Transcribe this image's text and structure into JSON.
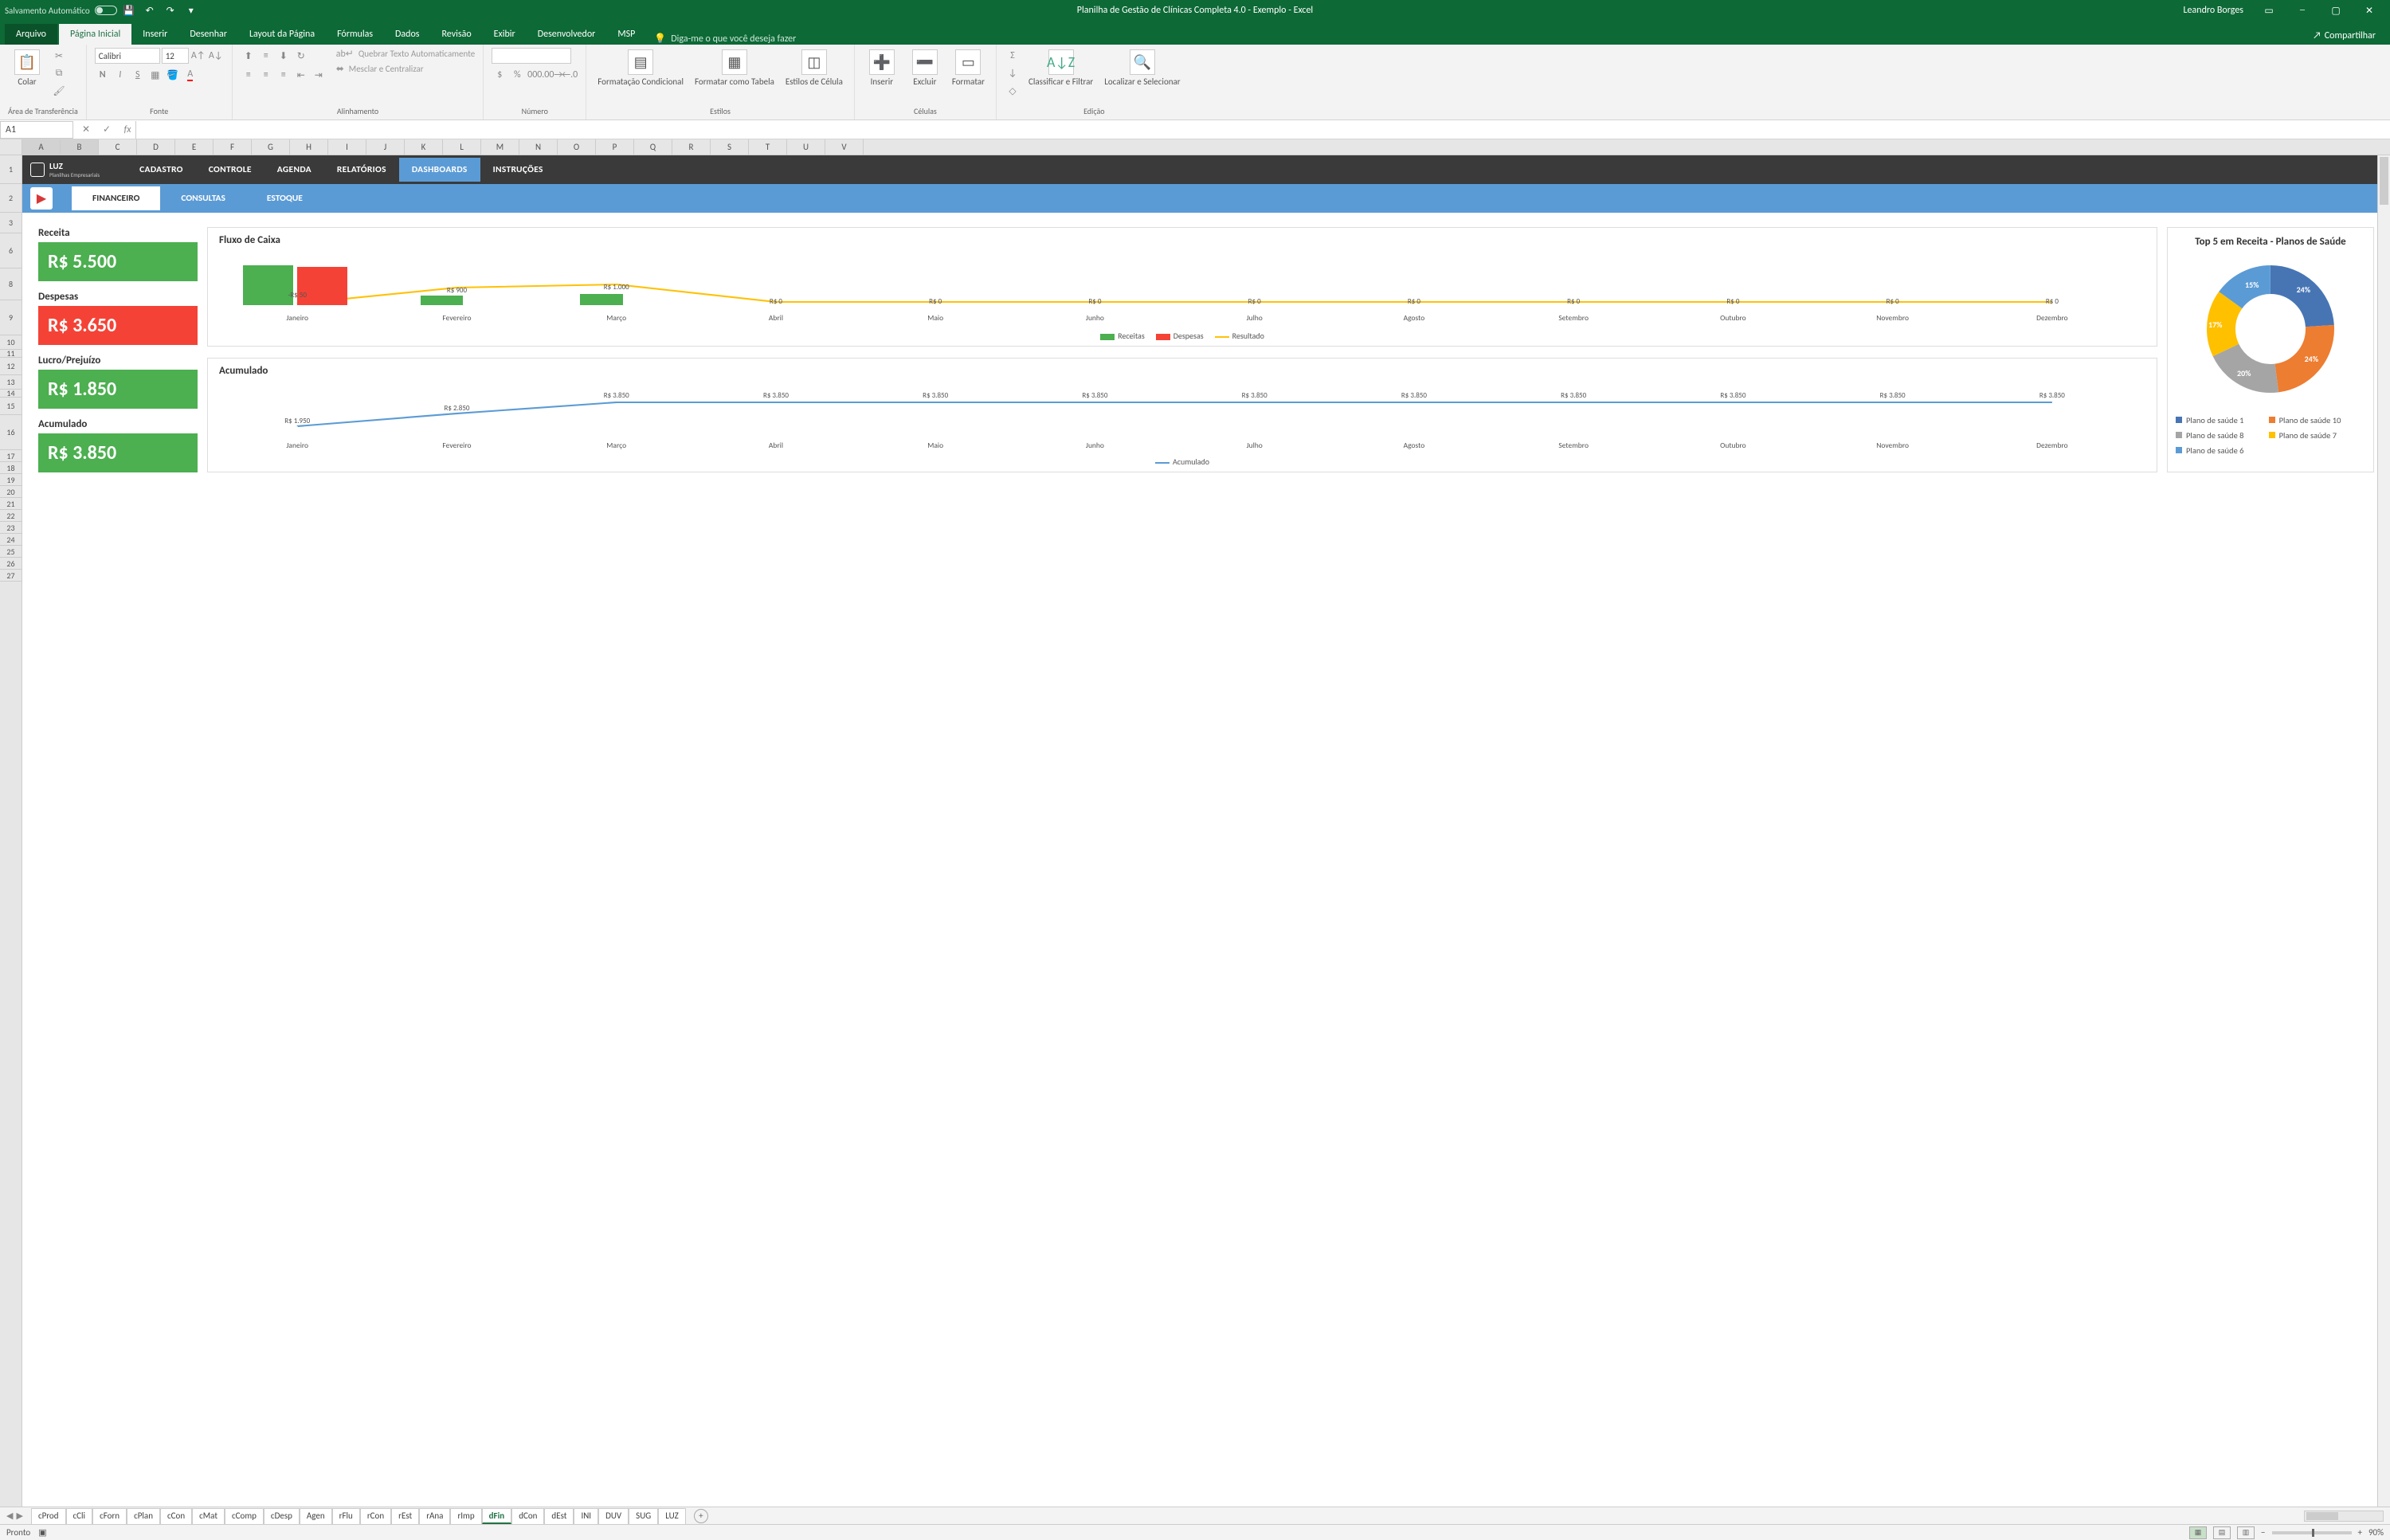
{
  "title_bar": {
    "autosave_label": "Salvamento Automático",
    "doc_title": "Planilha de Gestão de Clínicas Completa 4.0 - Exemplo  -  Excel",
    "user": "Leandro Borges"
  },
  "ribbon_tabs": {
    "file": "Arquivo",
    "tabs": [
      "Página Inicial",
      "Inserir",
      "Desenhar",
      "Layout da Página",
      "Fórmulas",
      "Dados",
      "Revisão",
      "Exibir",
      "Desenvolvedor",
      "MSP"
    ],
    "active_index": 0,
    "tell_me": "Diga-me o que você deseja fazer",
    "share": "Compartilhar"
  },
  "ribbon": {
    "clipboard": {
      "paste": "Colar",
      "group": "Área de Transferência"
    },
    "font": {
      "name": "Calibri",
      "size": "12",
      "group": "Fonte"
    },
    "alignment": {
      "wrap": "Quebrar Texto Automaticamente",
      "merge": "Mesclar e Centralizar",
      "group": "Alinhamento"
    },
    "number": {
      "group": "Número"
    },
    "styles": {
      "cond": "Formatação Condicional",
      "table": "Formatar como Tabela",
      "cell": "Estilos de Célula",
      "group": "Estilos"
    },
    "cells": {
      "insert": "Inserir",
      "delete": "Excluir",
      "format": "Formatar",
      "group": "Células"
    },
    "editing": {
      "sort": "Classificar e Filtrar",
      "find": "Localizar e Selecionar",
      "group": "Edição"
    }
  },
  "namebox": "A1",
  "columns": [
    "A",
    "B",
    "C",
    "D",
    "E",
    "F",
    "G",
    "H",
    "I",
    "J",
    "K",
    "L",
    "M",
    "N",
    "O",
    "P",
    "Q",
    "R",
    "S",
    "T",
    "U",
    "V"
  ],
  "rows": [
    "1",
    "2",
    "3",
    "6",
    "8",
    "9",
    "10",
    "11",
    "12",
    "13",
    "14",
    "15",
    "16",
    "17",
    "18",
    "19",
    "20",
    "21",
    "22",
    "23",
    "24",
    "25",
    "26",
    "27"
  ],
  "nav": {
    "brand": "LUZ",
    "brand_sub": "Planilhas Empresariais",
    "items": [
      "CADASTRO",
      "CONTROLE",
      "AGENDA",
      "RELATÓRIOS",
      "DASHBOARDS",
      "INSTRUÇÕES"
    ],
    "active_index": 4,
    "subtabs": [
      "FINANCEIRO",
      "CONSULTAS",
      "ESTOQUE"
    ],
    "sub_active_index": 0
  },
  "kpis": [
    {
      "label": "Receita",
      "value": "R$ 5.500",
      "color": "kg"
    },
    {
      "label": "Despesas",
      "value": "R$ 3.650",
      "color": "kr"
    },
    {
      "label": "Lucro/Prejuízo",
      "value": "R$ 1.850",
      "color": "kg"
    },
    {
      "label": "Acumulado",
      "value": "R$ 3.850",
      "color": "kg"
    }
  ],
  "chart_data": [
    {
      "type": "bar",
      "title": "Fluxo de Caixa",
      "categories": [
        "Janeiro",
        "Fevereiro",
        "Março",
        "Abril",
        "Maio",
        "Junho",
        "Julho",
        "Agosto",
        "Setembro",
        "Outubro",
        "Novembro",
        "Dezembro"
      ],
      "series": [
        {
          "name": "Receitas",
          "color": "#4caf50",
          "values": [
            5500,
            0,
            0,
            0,
            0,
            0,
            0,
            0,
            0,
            0,
            0,
            0
          ]
        },
        {
          "name": "Despesas",
          "color": "#f44336",
          "values": [
            3650,
            0,
            0,
            0,
            0,
            0,
            0,
            0,
            0,
            0,
            0,
            0
          ]
        },
        {
          "name": "Resultado",
          "color": "#ffc107",
          "type": "line",
          "values": [
            -50,
            900,
            1000,
            0,
            0,
            0,
            0,
            0,
            0,
            0,
            0,
            0
          ]
        }
      ],
      "data_labels_resultado": [
        "-R$ 50",
        "R$ 900",
        "R$ 1.000",
        "R$ 0",
        "R$ 0",
        "R$ 0",
        "R$ 0",
        "R$ 0",
        "R$ 0",
        "R$ 0",
        "R$ 0",
        "R$ 0"
      ]
    },
    {
      "type": "line",
      "title": "Acumulado",
      "categories": [
        "Janeiro",
        "Fevereiro",
        "Março",
        "Abril",
        "Maio",
        "Junho",
        "Julho",
        "Agosto",
        "Setembro",
        "Outubro",
        "Novembro",
        "Dezembro"
      ],
      "series": [
        {
          "name": "Acumulado",
          "color": "#5b9bd5",
          "values": [
            1950,
            2850,
            3850,
            3850,
            3850,
            3850,
            3850,
            3850,
            3850,
            3850,
            3850,
            3850
          ]
        }
      ],
      "data_labels": [
        "R$ 1.950",
        "R$ 2.850",
        "R$ 3.850",
        "R$ 3.850",
        "R$ 3.850",
        "R$ 3.850",
        "R$ 3.850",
        "R$ 3.850",
        "R$ 3.850",
        "R$ 3.850",
        "R$ 3.850",
        "R$ 3.850"
      ]
    },
    {
      "type": "pie",
      "title": "Top 5 em Receita - Planos de Saúde",
      "slices": [
        {
          "name": "Plano de saúde 1",
          "value": 24,
          "color": "#4775b4"
        },
        {
          "name": "Plano de saúde 10",
          "value": 24,
          "color": "#ed7d31"
        },
        {
          "name": "Plano de saúde 8",
          "value": 20,
          "color": "#a5a5a5"
        },
        {
          "name": "Plano de saúde 7",
          "value": 17,
          "color": "#ffc000"
        },
        {
          "name": "Plano de saúde 6",
          "value": 15,
          "color": "#5b9bd5"
        }
      ]
    }
  ],
  "sheet_tabs": [
    "cProd",
    "cCli",
    "cForn",
    "cPlan",
    "cCon",
    "cMat",
    "cComp",
    "cDesp",
    "Agen",
    "rFlu",
    "rCon",
    "rEst",
    "rAna",
    "rImp",
    "dFin",
    "dCon",
    "dEst",
    "INI",
    "DUV",
    "SUG",
    "LUZ"
  ],
  "active_sheet": "dFin",
  "status": {
    "ready": "Pronto",
    "zoom": "90%"
  }
}
